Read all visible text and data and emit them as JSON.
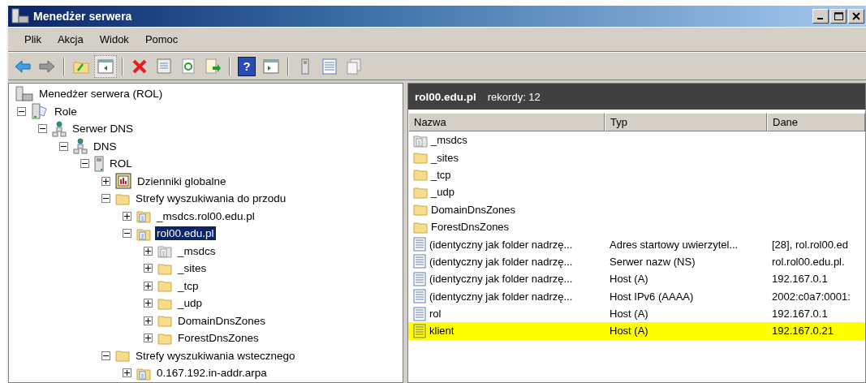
{
  "window": {
    "title": "Menedżer serwera"
  },
  "menu": [
    "Plik",
    "Akcja",
    "Widok",
    "Pomoc"
  ],
  "toolbar": [
    {
      "kind": "back",
      "pressed": false
    },
    {
      "kind": "forward",
      "pressed": false
    },
    {
      "kind": "separator"
    },
    {
      "kind": "up",
      "pressed": false
    },
    {
      "kind": "tree",
      "pressed": true
    },
    {
      "kind": "separator"
    },
    {
      "kind": "delete",
      "pressed": false
    },
    {
      "kind": "properties",
      "pressed": false
    },
    {
      "kind": "refresh",
      "pressed": false
    },
    {
      "kind": "export",
      "pressed": false
    },
    {
      "kind": "separator"
    },
    {
      "kind": "help",
      "label": "?",
      "pressed": false
    },
    {
      "kind": "action-pane",
      "pressed": false
    },
    {
      "kind": "separator"
    },
    {
      "kind": "server",
      "pressed": false
    },
    {
      "kind": "list",
      "pressed": false
    },
    {
      "kind": "copy",
      "pressed": false
    }
  ],
  "tree": [
    {
      "label": "Menedżer serwera (ROL)",
      "kind": "server-manager",
      "selected": false,
      "children": [
        {
          "label": "Role",
          "kind": "roles",
          "expanded": true,
          "selected": false,
          "children": [
            {
              "label": "Serwer DNS",
              "kind": "dns",
              "expanded": true,
              "selected": false,
              "children": [
                {
                  "label": "DNS",
                  "kind": "dns",
                  "expanded": true,
                  "selected": false,
                  "children": [
                    {
                      "label": "ROL",
                      "kind": "server",
                      "expanded": true,
                      "selected": false,
                      "children": [
                        {
                          "label": "Dzienniki globalne",
                          "kind": "log",
                          "expanded": false,
                          "selected": false
                        },
                        {
                          "label": "Strefy wyszukiwania do przodu",
                          "kind": "folder",
                          "expanded": true,
                          "selected": false,
                          "children": [
                            {
                              "label": "_msdcs.rol00.edu.pl",
                              "kind": "zone",
                              "expanded": false,
                              "selected": false
                            },
                            {
                              "label": "rol00.edu.pl",
                              "kind": "zone",
                              "expanded": true,
                              "selected": true,
                              "children": [
                                {
                                  "label": "_msdcs",
                                  "kind": "zone-gray",
                                  "expanded": false,
                                  "selected": false
                                },
                                {
                                  "label": "_sites",
                                  "kind": "folder",
                                  "expanded": false,
                                  "selected": false
                                },
                                {
                                  "label": "_tcp",
                                  "kind": "folder",
                                  "expanded": false,
                                  "selected": false
                                },
                                {
                                  "label": "_udp",
                                  "kind": "folder",
                                  "expanded": false,
                                  "selected": false
                                },
                                {
                                  "label": "DomainDnsZones",
                                  "kind": "folder",
                                  "expanded": false,
                                  "selected": false
                                },
                                {
                                  "label": "ForestDnsZones",
                                  "kind": "folder",
                                  "expanded": false,
                                  "selected": false
                                }
                              ]
                            }
                          ]
                        },
                        {
                          "label": "Strefy wyszukiwania wstecznego",
                          "kind": "folder",
                          "expanded": true,
                          "selected": false,
                          "children": [
                            {
                              "label": "0.167.192.in-addr.arpa",
                              "kind": "zone",
                              "expanded": false,
                              "selected": false
                            }
                          ]
                        }
                      ]
                    }
                  ]
                }
              ]
            }
          ]
        }
      ]
    }
  ],
  "details": {
    "title": "rol00.edu.pl",
    "count": "rekordy: 12",
    "columns": [
      "Nazwa",
      "Typ",
      "Dane"
    ],
    "rows": [
      {
        "kind": "zone-gray",
        "name": "_msdcs",
        "highlighted": false
      },
      {
        "kind": "folder",
        "name": "_sites",
        "highlighted": false
      },
      {
        "kind": "folder",
        "name": "_tcp",
        "highlighted": false
      },
      {
        "kind": "folder",
        "name": "_udp",
        "highlighted": false
      },
      {
        "kind": "folder",
        "name": "DomainDnsZones",
        "highlighted": false
      },
      {
        "kind": "folder",
        "name": "ForestDnsZones",
        "highlighted": false
      },
      {
        "kind": "record",
        "name": "(identyczny jak folder nadrzę...",
        "type": "Adres startowy uwierzytel...",
        "data": "[28], rol.rol00.ed",
        "highlighted": false
      },
      {
        "kind": "record",
        "name": "(identyczny jak folder nadrzę...",
        "type": "Serwer nazw (NS)",
        "data": "rol.rol00.edu.pl.",
        "highlighted": false
      },
      {
        "kind": "record",
        "name": "(identyczny jak folder nadrzę...",
        "type": "Host (A)",
        "data": "192.167.0.1",
        "highlighted": false
      },
      {
        "kind": "record",
        "name": "(identyczny jak folder nadrzę...",
        "type": "Host IPv6 (AAAA)",
        "data": "2002:c0a7:0001:",
        "highlighted": false
      },
      {
        "kind": "record",
        "name": "rol",
        "type": "Host (A)",
        "data": "192.167.0.1",
        "highlighted": false
      },
      {
        "kind": "record",
        "name": "klient",
        "type": "Host (A)",
        "data": "192.167.0.21",
        "highlighted": true
      }
    ]
  }
}
